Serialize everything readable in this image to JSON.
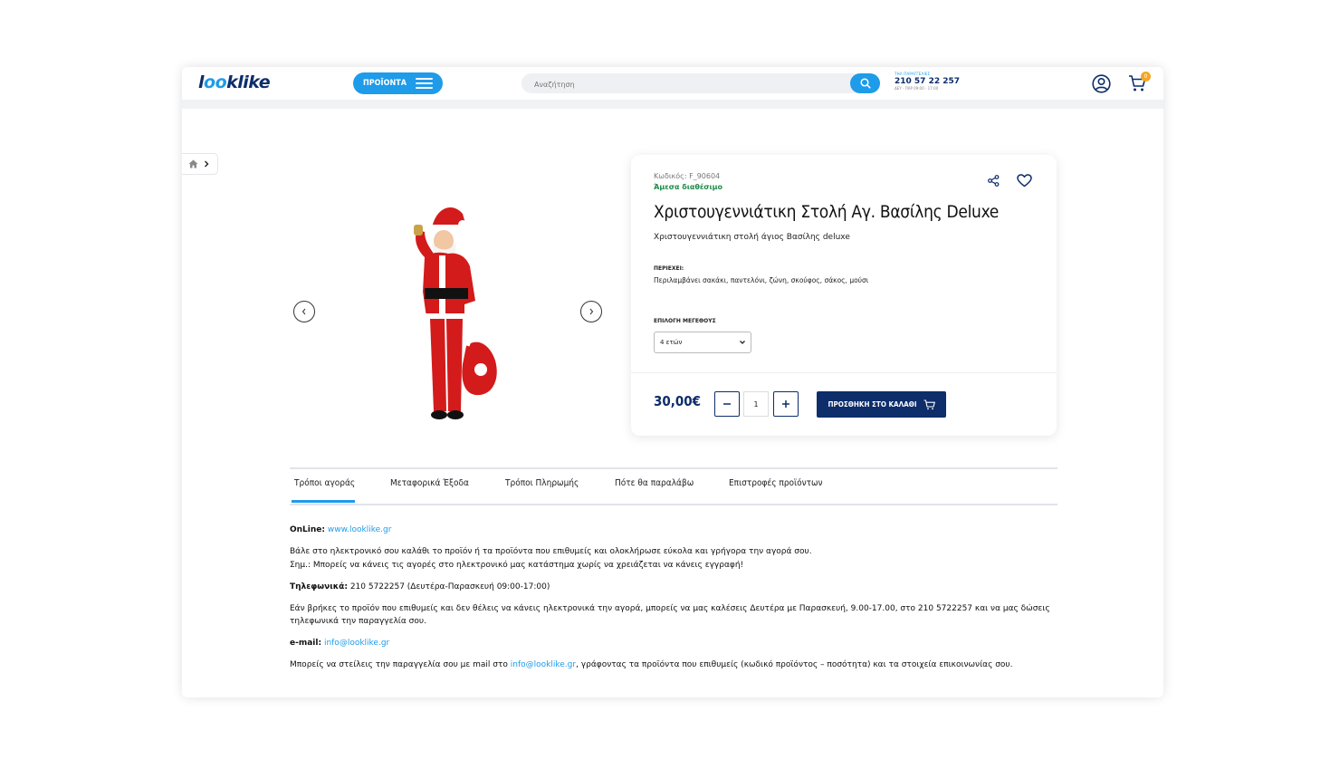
{
  "header": {
    "logo_prefix": "l",
    "logo_eyes": "oo",
    "logo_suffix": "klike",
    "products_label": "ΠΡΟΪΟΝΤΑ",
    "search_placeholder": "Αναζήτηση",
    "phone_label": "ΤΗΛ ΠΑΡΑΓΓΕΛΙΕΣ",
    "phone_number": "210 57 22 257",
    "phone_hours": "ΔΕΥ - ΠΑΡ 09:00 - 17:00",
    "cart_count": "0",
    "icons": [
      "hamburger-icon",
      "search-icon",
      "user-icon",
      "cart-icon"
    ]
  },
  "breadcrumb": {
    "icons": [
      "home-icon",
      "chevron-right-icon"
    ]
  },
  "product": {
    "sku": "Κωδικός: F_90604",
    "availability": "Άμεσα διαθέσιμο",
    "title": "Χριστουγεννιάτικη Στολή Αγ. Βασίλης Deluxe",
    "description": "Χριστουγεννιάτικη στολή άγιος Βασίλης deluxe",
    "contents_label": "ΠΕΡΙΕΧΕΙ:",
    "contents_text": "Περιλαμβάνει σακάκι, παντελόνι, ζώνη, σκούφος, σάκος, μούσι",
    "size_label": "ΕΠΙΛΟΓΗ ΜΕΓΕΘΟΥΣ",
    "size_selected": "4 ετών",
    "price": "30,00€",
    "quantity": "1",
    "add_to_cart": "ΠΡΟΣΘΗΚΗ ΣΤΟ ΚΑΛΑΘΙ",
    "icons": [
      "share-icon",
      "heart-icon",
      "minus-icon",
      "plus-icon",
      "cart-icon"
    ],
    "colors": {
      "brand_dark": "#0d2d6b",
      "brand_blue": "#1e9be9",
      "available": "#1d8b4a"
    }
  },
  "tabs": [
    "Τρόποι αγοράς",
    "Μεταφορικά Έξοδα",
    "Τρόποι Πληρωμής",
    "Πότε θα παραλάβω",
    "Επιστροφές προϊόντων"
  ],
  "info": {
    "online_label": "OnLine:",
    "online_link": "www.looklike.gr",
    "p1_line1": "Βάλε στο ηλεκτρονικό σου καλάθι το προϊόν ή τα προϊόντα που επιθυμείς και ολοκλήρωσε εύκολα και γρήγορα την αγορά σου.",
    "p1_line2": "Σημ.: Μπορείς να κάνεις τις αγορές στο ηλεκτρονικό μας κατάστημα χωρίς να χρειάζεται να κάνεις εγγραφή!",
    "phone_label": "Τηλεφωνικά:",
    "phone_text": "210 5722257 (Δευτέρα-Παρασκευή 09:00-17:00)",
    "p2": "Εάν βρήκες το προϊόν που επιθυμείς και δεν θέλεις να κάνεις ηλεκτρονικά την αγορά, μπορείς να μας καλέσεις Δευτέρα με Παρασκευή, 9.00-17.00, στο 210 5722257 και να μας δώσεις τηλεφωνικά την παραγγελία σου.",
    "email_label": "e-mail:",
    "email": "info@looklike.gr",
    "p3_before": "Μπορείς να στείλεις την παραγγελία σου με mail στο ",
    "p3_link": "info@looklike.gr",
    "p3_after": ", γράφοντας τα προϊόντα που επιθυμείς (κωδικό προϊόντος – ποσότητα) και τα στοιχεία επικοινωνίας σου."
  }
}
